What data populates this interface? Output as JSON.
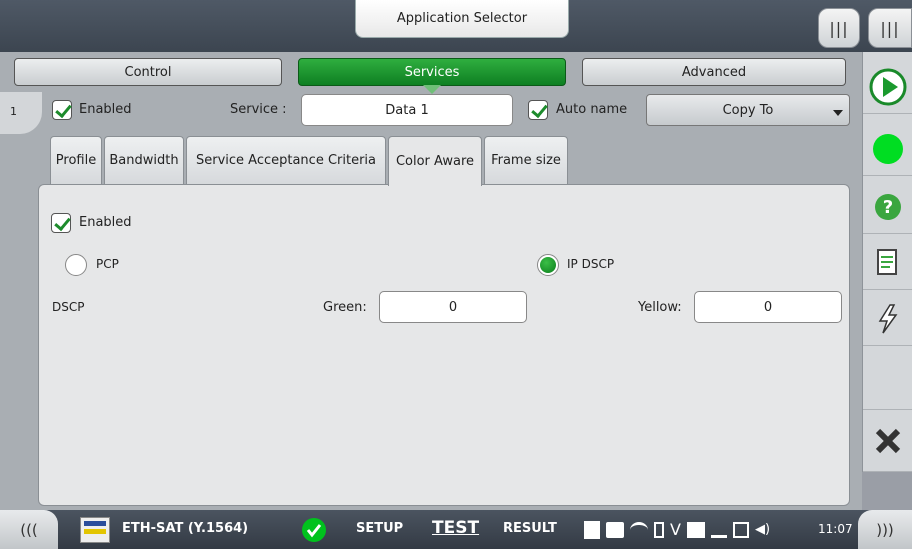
{
  "app_selector": "Application Selector",
  "nav": {
    "control": "Control",
    "services": "Services",
    "advanced": "Advanced"
  },
  "service_index": "1",
  "service_row": {
    "enabled_label": "Enabled",
    "service_label": "Service :",
    "service_value": "Data 1",
    "auto_name_label": "Auto name",
    "copy_to_label": "Copy To"
  },
  "tabs": [
    "Profile",
    "Bandwidth",
    "Service Acceptance Criteria",
    "Color Aware",
    "Frame size"
  ],
  "active_tab": "Color Aware",
  "color_aware": {
    "enabled_label": "Enabled",
    "pcp_label": "PCP",
    "ipdscp_label": "IP DSCP",
    "dscp_label": "DSCP",
    "green_label": "Green:",
    "green_value": "0",
    "yellow_label": "Yellow:",
    "yellow_value": "0"
  },
  "right_icons": [
    "play-icon",
    "status-green-icon",
    "help-icon",
    "report-icon",
    "lightning-icon",
    "close-icon"
  ],
  "statusbar": {
    "app_name": "ETH-SAT (Y.1564)",
    "setup": "SETUP",
    "test": "TEST",
    "result": "RESULT",
    "time": "11:07"
  },
  "colors": {
    "active_green": "#1a9a2d",
    "status_green": "#00dd22"
  }
}
